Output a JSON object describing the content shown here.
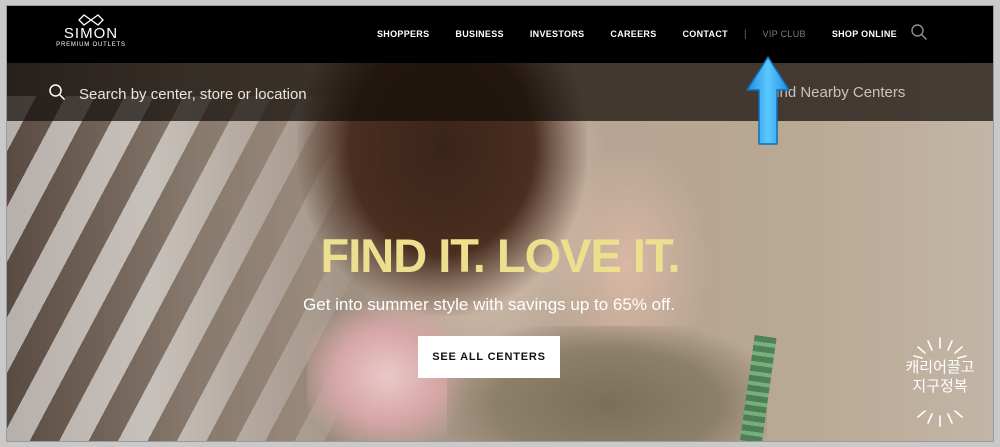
{
  "brand": {
    "name": "SIMON",
    "sub": "PREMIUM OUTLETS"
  },
  "nav": {
    "items": [
      "SHOPPERS",
      "BUSINESS",
      "INVESTORS",
      "CAREERS",
      "CONTACT"
    ],
    "separator": "|",
    "vip": "VIP CLUB",
    "shop_online": "SHOP ONLINE"
  },
  "search": {
    "placeholder": "Search by center, store or location",
    "find_nearby": "Find Nearby Centers"
  },
  "hero": {
    "headline": "FIND IT. LOVE IT.",
    "subline": "Get into summer style with savings up to 65% off.",
    "cta": "SEE ALL CENTERS"
  },
  "watermark": {
    "line1": "캐리어끌고",
    "line2": "지구정복"
  },
  "colors": {
    "headline": "#ecdf8d",
    "nav_bg": "#000000",
    "arrow": "#2aa7f4"
  }
}
